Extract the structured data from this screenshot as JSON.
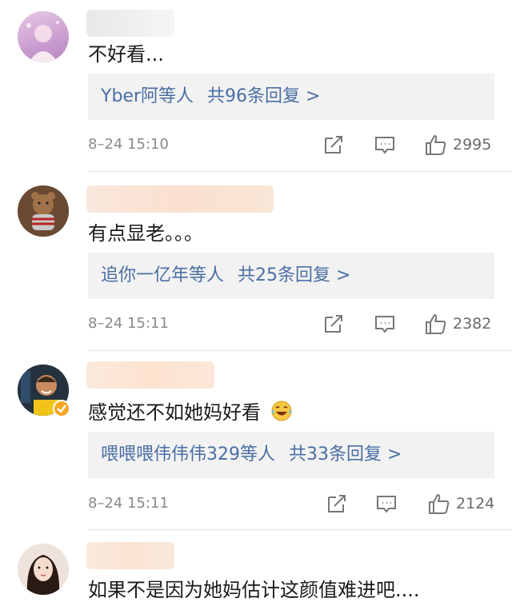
{
  "comments": [
    {
      "text": "不好看...",
      "reply_users": "Yber阿等人",
      "reply_count": "共96条回复 >",
      "time": "8–24 15:10",
      "likes": "2995"
    },
    {
      "text": "有点显老。。。",
      "reply_users": "追你一亿年等人",
      "reply_count": "共25条回复 >",
      "time": "8–24 15:11",
      "likes": "2382"
    },
    {
      "text": "感觉还不如她妈好看",
      "reply_users": "喂喂喂伟伟伟329等人",
      "reply_count": "共33条回复 >",
      "time": "8–24 15:11",
      "likes": "2124"
    },
    {
      "text": "如果不是因为她妈估计这颜值难进吧....",
      "reply_users": "",
      "reply_count": "",
      "time": "",
      "likes": ""
    }
  ],
  "icons": {
    "share": "share-icon",
    "comment": "comment-icon",
    "like": "thumbs-up-icon",
    "emoji": "laughing-crying-emoji-icon",
    "verified": "verified-badge-icon"
  },
  "colors": {
    "link": "#4a6ea4",
    "reply_bg": "#f2f2f2",
    "meta_text": "#8a8a8a",
    "verified": "#f5a623"
  }
}
